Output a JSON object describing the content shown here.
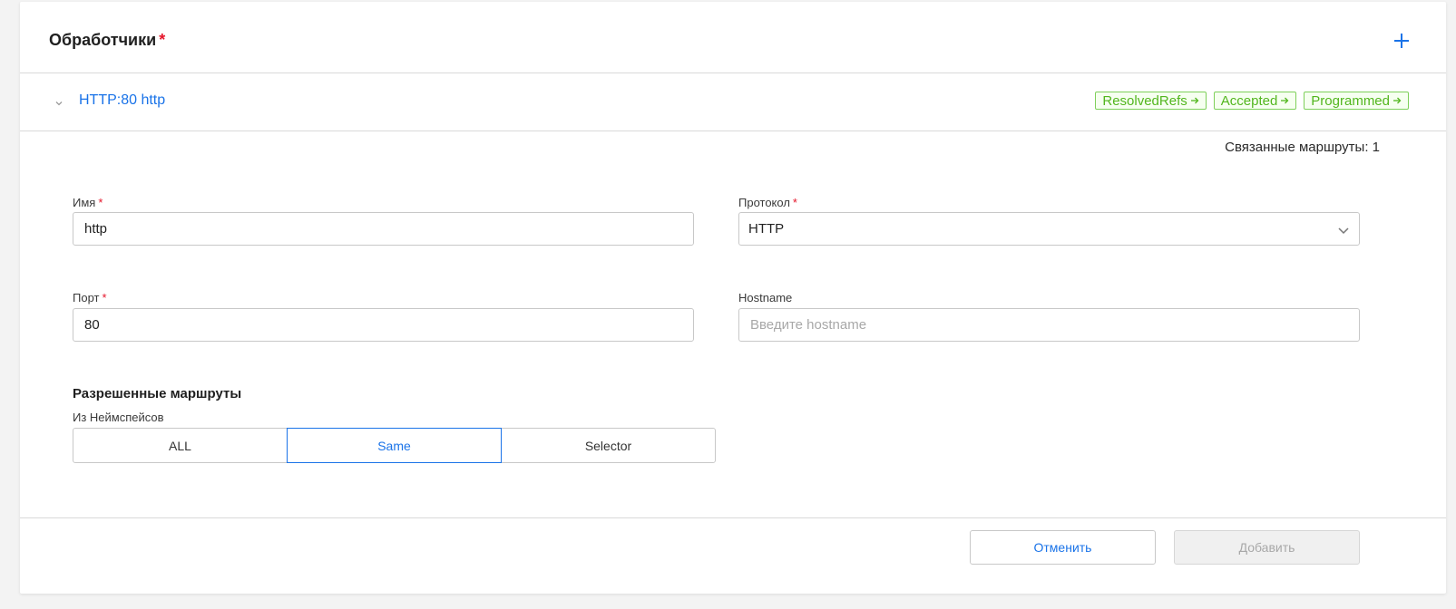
{
  "card": {
    "title": "Обработчики",
    "required_mark": "*"
  },
  "listener": {
    "title": "HTTP:80 http",
    "statuses": [
      {
        "label": "ResolvedRefs"
      },
      {
        "label": "Accepted"
      },
      {
        "label": "Programmed"
      }
    ]
  },
  "linked_routes": "Связанные маршруты: 1",
  "form": {
    "name": {
      "label": "Имя",
      "required": "*",
      "value": "http"
    },
    "protocol": {
      "label": "Протокол",
      "required": "*",
      "value": "HTTP"
    },
    "port": {
      "label": "Порт",
      "required": "*",
      "value": "80"
    },
    "hostname": {
      "label": "Hostname",
      "placeholder": "Введите hostname",
      "value": ""
    }
  },
  "allowed_routes": {
    "title": "Разрешенные маршруты",
    "from_namespaces_label": "Из Неймспейсов",
    "options": [
      {
        "label": "ALL",
        "active": false
      },
      {
        "label": "Same",
        "active": true
      },
      {
        "label": "Selector",
        "active": false
      }
    ]
  },
  "footer": {
    "cancel_label": "Отменить",
    "add_label": "Добавить"
  },
  "colors": {
    "accent": "#1a73e8",
    "required": "#e5162b",
    "status_green": "#52b61e"
  },
  "icons": {
    "add": "plus-icon",
    "collapse": "chevron-down-icon",
    "status_arrow": "arrow-right-icon",
    "select": "chevron-down-icon"
  }
}
